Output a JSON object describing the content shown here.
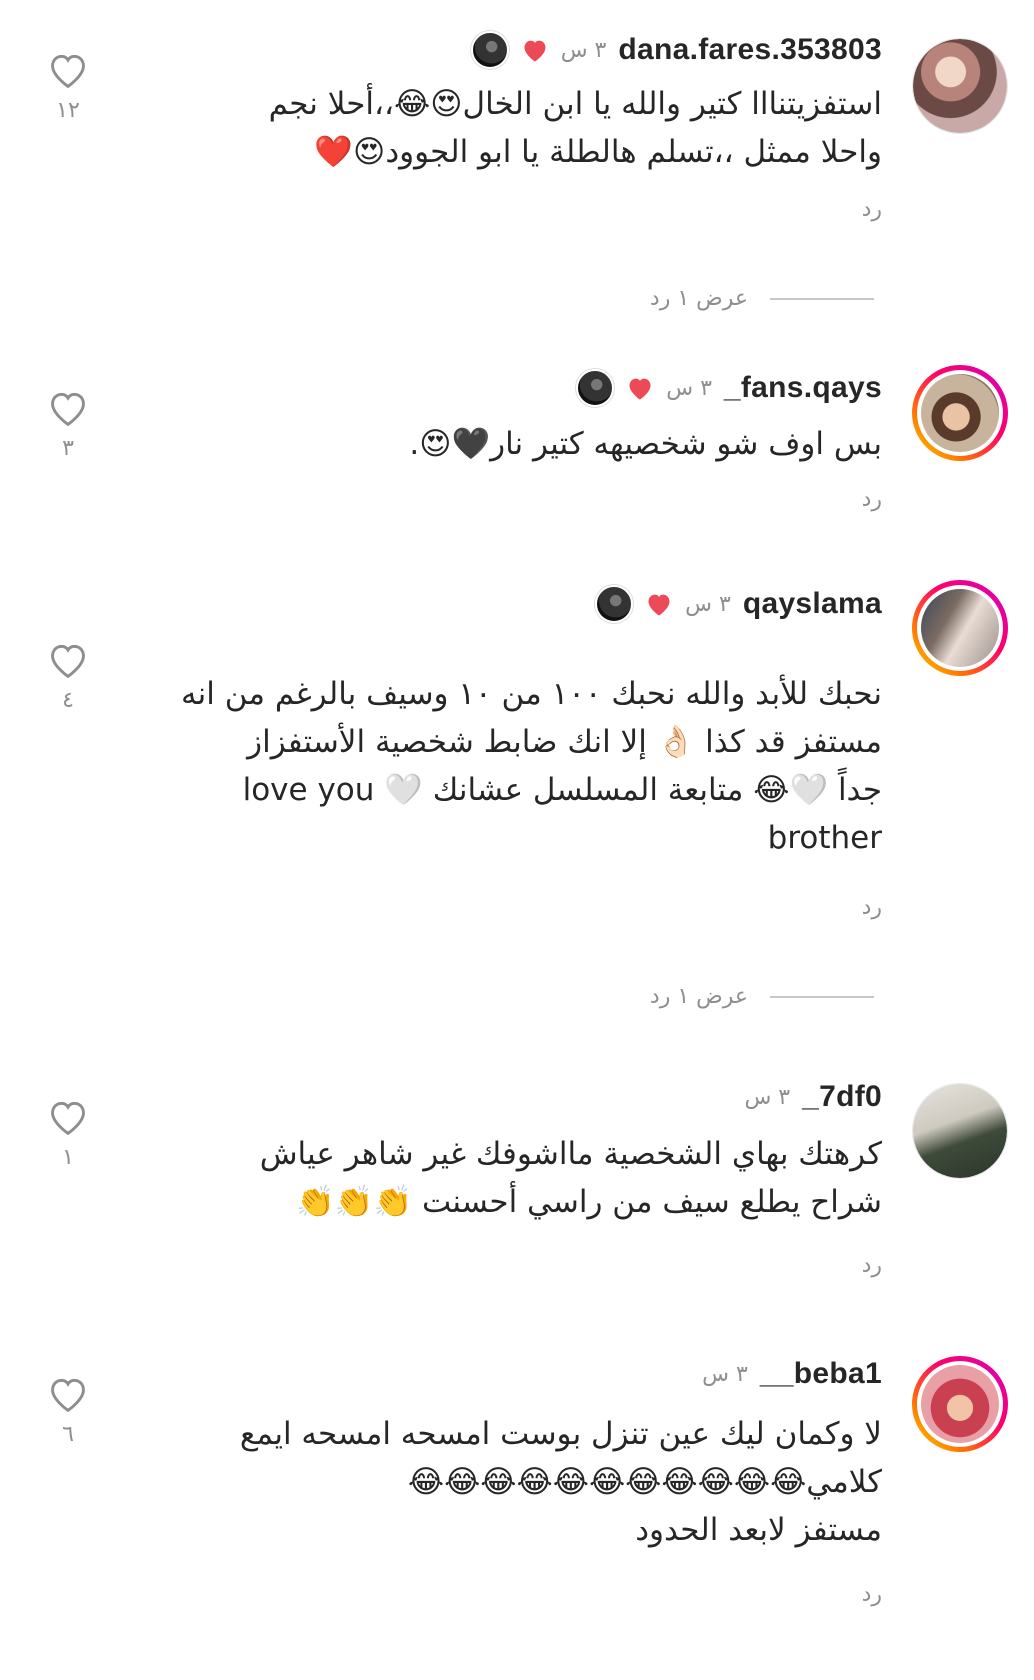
{
  "comments": [
    {
      "username": "dana.fares.353803",
      "time": "٣ س",
      "liked_by_author": true,
      "text": "استفزيتنااا كتير والله يا ابن الخال😍😂،،أحلا نجم\nواحلا ممثل ،،تسلم هالطلة يا ابو الجوود😍❤️",
      "reply_label": "رد",
      "like_count": "١٢",
      "view_replies": "عرض ١ رد"
    },
    {
      "username": "_fans.qays",
      "time": "٣ س",
      "liked_by_author": true,
      "text": "بس اوف شو شخصيهه كتير نار🖤😍.",
      "reply_label": "رد",
      "like_count": "٣"
    },
    {
      "username": "qayslama",
      "time": "٣ س",
      "liked_by_author": true,
      "text": "نحبك للأبد والله نحبك ١٠٠ من ١٠ وسيف بالرغم من انه\nمستفز قد كذا 👌🏻 إلا انك ضابط شخصية الأستفزاز\nجداً 🤍😂 متابعة المسلسل عشانك 🤍 love you\nbrother",
      "reply_label": "رد",
      "like_count": "٤",
      "view_replies": "عرض ١ رد"
    },
    {
      "username": "_7df0",
      "time": "٣ س",
      "liked_by_author": false,
      "text": "كرهتك بهاي الشخصية مااشوفك غير شاهر عياش\nشراح يطلع سيف من راسي أحسنت 👏👏👏",
      "reply_label": "رد",
      "like_count": "١"
    },
    {
      "username": "__beba1",
      "time": "٣ س",
      "liked_by_author": false,
      "text": "لا وكمان ليك عين تنزل بوست امسحه امسحه ايمع\nكلامي😂😂😂😂😂😂😂😂😂😂😂\nمستفز لابعد الحدود",
      "reply_label": "رد",
      "like_count": "٦"
    }
  ],
  "colors": {
    "text": "#262626",
    "secondary": "#8e8e8e",
    "heart_red": "#ed4956"
  },
  "icons": {
    "like": "heart-outline-icon",
    "author_like": "heart-filled-icon"
  }
}
